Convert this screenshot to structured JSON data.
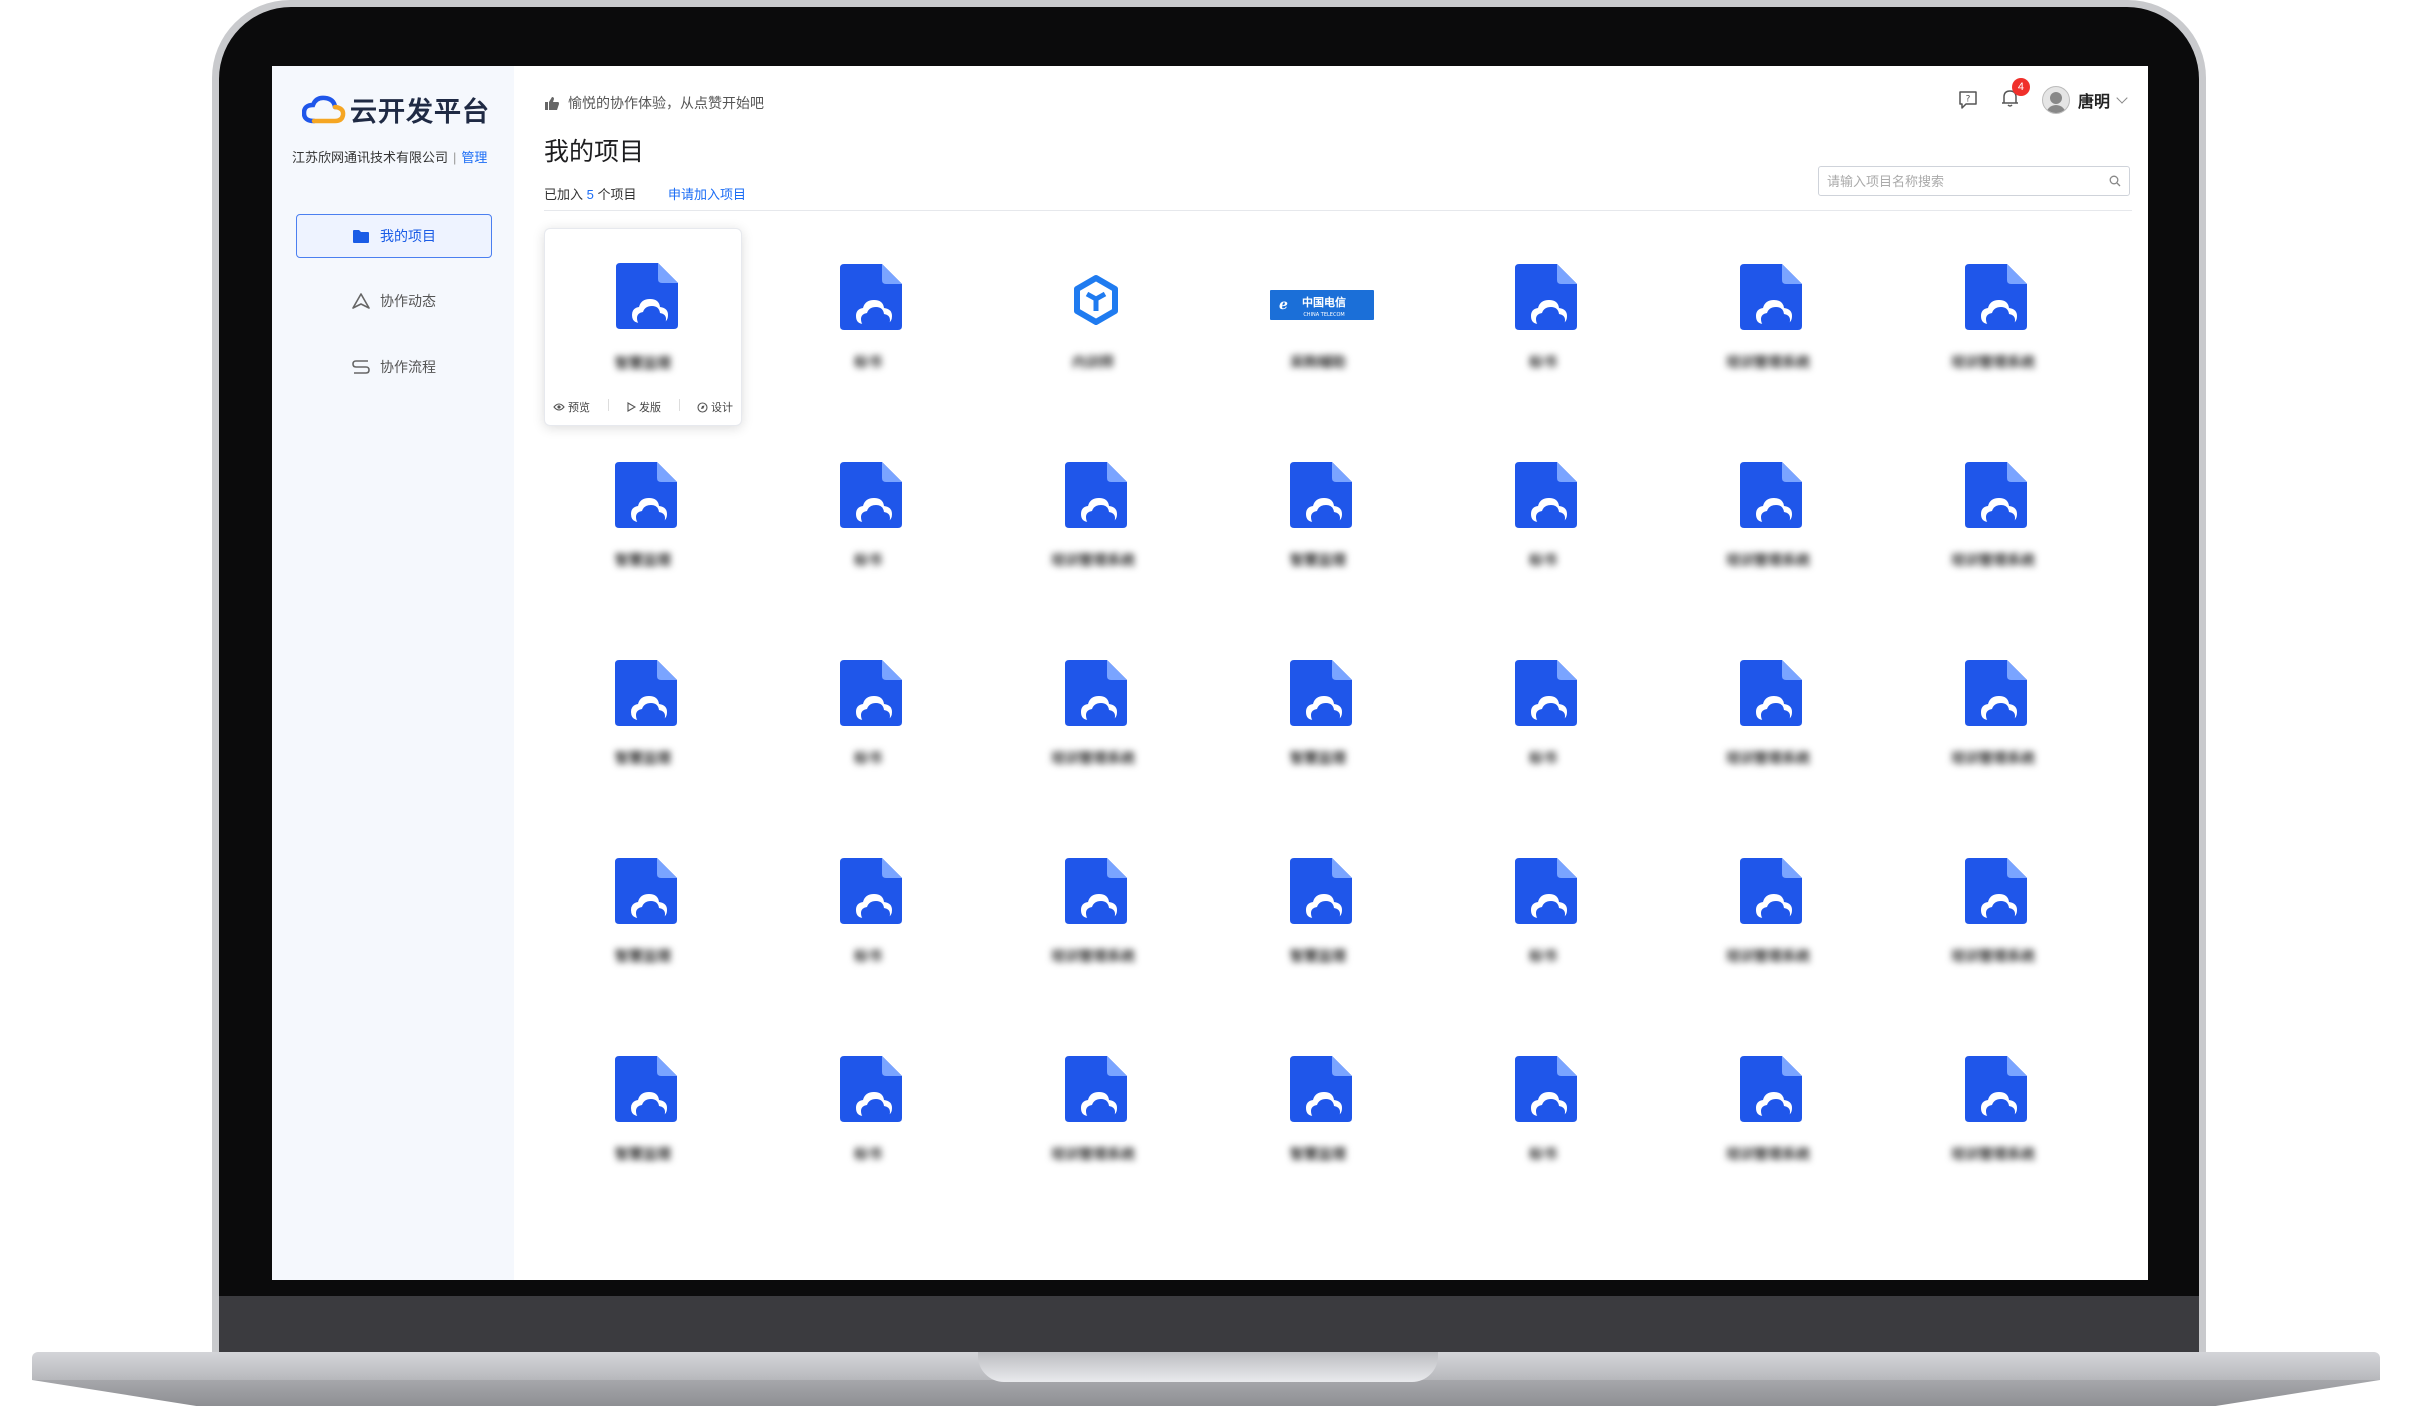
{
  "app": {
    "logo_text": "云开发平台",
    "company": "江苏欣网通讯技术有限公司",
    "separator": "|",
    "manage_label": "管理"
  },
  "sidebar": {
    "items": [
      {
        "label": "我的项目",
        "icon": "folder-icon",
        "active": true
      },
      {
        "label": "协作动态",
        "icon": "triangle-nav-icon",
        "active": false
      },
      {
        "label": "协作流程",
        "icon": "flow-icon",
        "active": false
      }
    ]
  },
  "header": {
    "slogan": "愉悦的协作体验，从点赞开始吧",
    "notification_count": "4",
    "user_name": "唐明"
  },
  "page": {
    "title": "我的项目",
    "joined_prefix": "已加入",
    "joined_count": "5",
    "joined_suffix": "个项目",
    "apply_link": "申请加入项目",
    "search_placeholder": "请输入项目名称搜索"
  },
  "card_actions": {
    "preview": "预览",
    "publish": "发版",
    "design": "设计"
  },
  "colors": {
    "accent": "#1a6cf5",
    "icon_blue": "#1f56ea",
    "telecom_blue": "#1b6fd8"
  },
  "projects": [
    {
      "name": "智慧监理",
      "icon": "project-file-icon"
    },
    {
      "name": "标书",
      "icon": "project-file-icon"
    },
    {
      "name": "内训师",
      "icon": "cube-logo-icon"
    },
    {
      "name": "采购辅助",
      "icon": "china-telecom-logo"
    },
    {
      "name": "标书",
      "icon": "project-file-icon"
    },
    {
      "name": "培训管理系统",
      "icon": "project-file-icon"
    },
    {
      "name": "培训管理系统",
      "icon": "project-file-icon"
    },
    {
      "name": "智慧监理",
      "icon": "project-file-icon"
    },
    {
      "name": "标书",
      "icon": "project-file-icon"
    },
    {
      "name": "培训管理系统",
      "icon": "project-file-icon"
    },
    {
      "name": "智慧监理",
      "icon": "project-file-icon"
    },
    {
      "name": "标书",
      "icon": "project-file-icon"
    },
    {
      "name": "培训管理系统",
      "icon": "project-file-icon"
    },
    {
      "name": "培训管理系统",
      "icon": "project-file-icon"
    },
    {
      "name": "智慧监理",
      "icon": "project-file-icon"
    },
    {
      "name": "标书",
      "icon": "project-file-icon"
    },
    {
      "name": "培训管理系统",
      "icon": "project-file-icon"
    },
    {
      "name": "智慧监理",
      "icon": "project-file-icon"
    },
    {
      "name": "标书",
      "icon": "project-file-icon"
    },
    {
      "name": "培训管理系统",
      "icon": "project-file-icon"
    },
    {
      "name": "培训管理系统",
      "icon": "project-file-icon"
    },
    {
      "name": "智慧监理",
      "icon": "project-file-icon"
    },
    {
      "name": "标书",
      "icon": "project-file-icon"
    },
    {
      "name": "培训管理系统",
      "icon": "project-file-icon"
    },
    {
      "name": "智慧监理",
      "icon": "project-file-icon"
    },
    {
      "name": "标书",
      "icon": "project-file-icon"
    },
    {
      "name": "培训管理系统",
      "icon": "project-file-icon"
    },
    {
      "name": "培训管理系统",
      "icon": "project-file-icon"
    },
    {
      "name": "智慧监理",
      "icon": "project-file-icon"
    },
    {
      "name": "标书",
      "icon": "project-file-icon"
    },
    {
      "name": "培训管理系统",
      "icon": "project-file-icon"
    },
    {
      "name": "智慧监理",
      "icon": "project-file-icon"
    },
    {
      "name": "标书",
      "icon": "project-file-icon"
    },
    {
      "name": "培训管理系统",
      "icon": "project-file-icon"
    },
    {
      "name": "培训管理系统",
      "icon": "project-file-icon"
    }
  ]
}
